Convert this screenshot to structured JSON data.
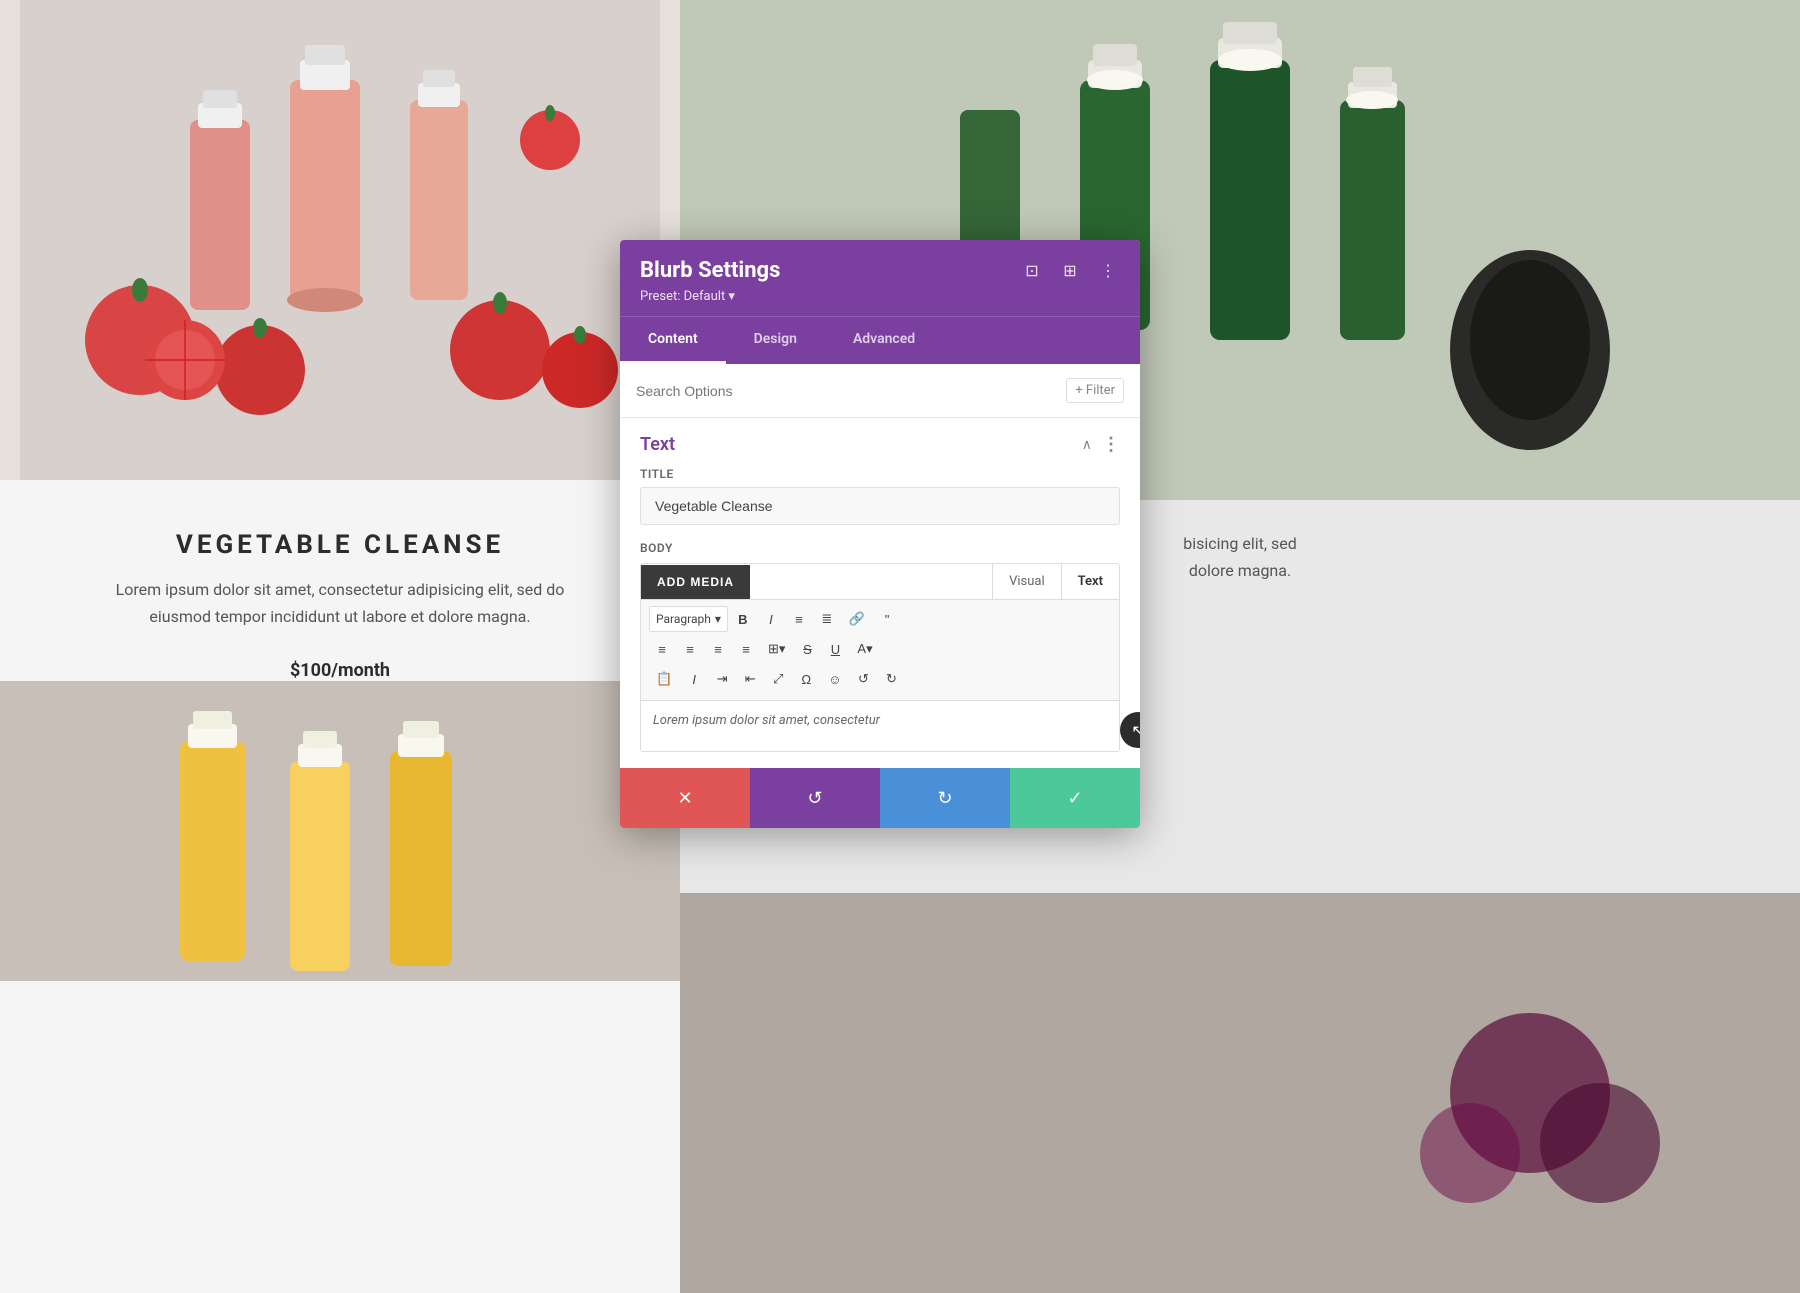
{
  "page": {
    "left_panel": {
      "product_title": "VEGETABLE CLEANSE",
      "product_description": "Lorem ipsum dolor sit amet, consectetur adipisicing elit, sed do eiusmod tempor incididunt ut labore et dolore magna.",
      "product_price": "$100/month"
    },
    "right_panel": {
      "description_partial_1": "bisicing elit, sed",
      "description_partial_2": "dolore magna."
    }
  },
  "modal": {
    "title": "Blurb Settings",
    "preset_label": "Preset: Default ▾",
    "tabs": [
      {
        "id": "content",
        "label": "Content",
        "active": true
      },
      {
        "id": "design",
        "label": "Design",
        "active": false
      },
      {
        "id": "advanced",
        "label": "Advanced",
        "active": false
      }
    ],
    "search_placeholder": "Search Options",
    "filter_label": "+ Filter",
    "section_title": "Text",
    "title_field_label": "Title",
    "title_field_value": "Vegetable Cleanse",
    "body_field_label": "Body",
    "add_media_label": "ADD MEDIA",
    "editor_tabs": [
      {
        "label": "Visual",
        "active": false
      },
      {
        "label": "Text",
        "active": true
      }
    ],
    "toolbar": {
      "paragraph_select": "Paragraph",
      "paragraph_dropdown": "▾"
    },
    "editor_content_preview": "Lorem ipsum dolor sit amet, consectetur",
    "footer_buttons": {
      "cancel_icon": "✕",
      "undo_icon": "↺",
      "redo_icon": "↻",
      "confirm_icon": "✓"
    }
  },
  "icons": {
    "expand_icon": "⊡",
    "grid_icon": "⊞",
    "more_icon": "⋮",
    "chevron_up": "∧",
    "collapse_icon": "^",
    "scroll_icon": "↖"
  }
}
